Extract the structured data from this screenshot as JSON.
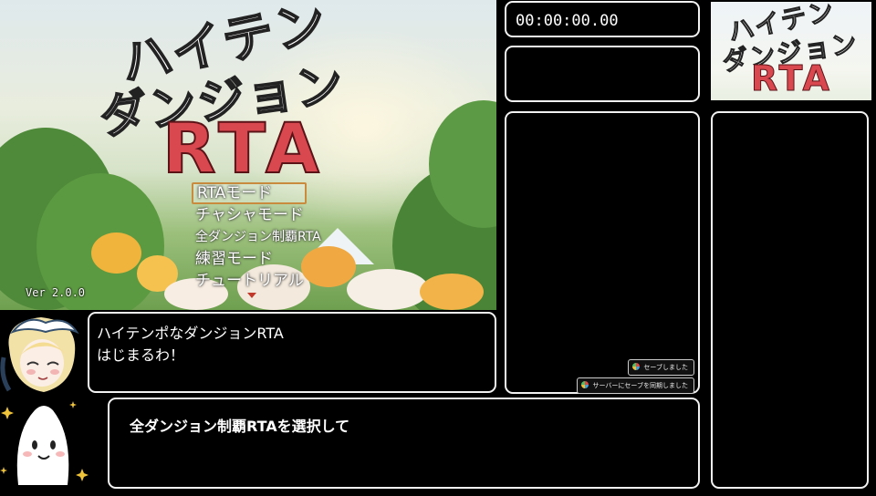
{
  "game": {
    "title_katakana_line1": "ハイテン",
    "title_katakana_line2": "ダンジョン",
    "title_rta": "RTA",
    "menu": [
      {
        "label": "RTAモード",
        "selected": true
      },
      {
        "label": "チャシャモード",
        "selected": false
      },
      {
        "label": "全ダンジョン制覇RTA",
        "selected": false
      },
      {
        "label": "練習モード",
        "selected": false
      },
      {
        "label": "チュートリアル",
        "selected": false
      }
    ],
    "version": "Ver 2.0.0"
  },
  "timer": {
    "value": "00:00:00.00"
  },
  "mini_logo": {
    "line1": "ハイテン",
    "line2": "ダンジョン",
    "rta": "RTA"
  },
  "toasts": {
    "saved": "セーブしました",
    "server_sync": "サーバーにセーブを同期しました"
  },
  "dialog": {
    "line1": "ハイテンポなダンジョンRTA",
    "line2": "はじまるわ！"
  },
  "subtitle": {
    "text": "全ダンジョン制覇RTAを選択して"
  },
  "colors": {
    "rta_red": "#d9474f",
    "menu_cursor": "#c98c3e",
    "panel_border": "#f2f2f2"
  }
}
